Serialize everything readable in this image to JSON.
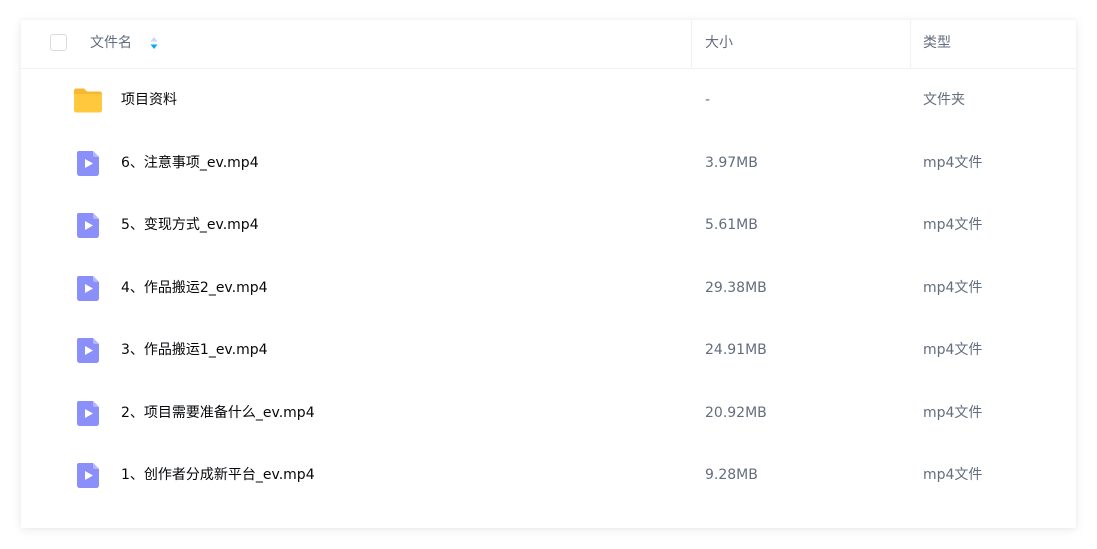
{
  "header": {
    "name_label": "文件名",
    "size_label": "大小",
    "type_label": "类型"
  },
  "colors": {
    "folder": "#ffc83d",
    "video_icon": "#8b8ffa",
    "sort_active": "#06a7ff",
    "sort_inactive": "#c4d9f5"
  },
  "files": [
    {
      "icon": "folder-icon",
      "name": "项目资料",
      "size": "-",
      "type": "文件夹"
    },
    {
      "icon": "video-file-icon",
      "name": "6、注意事项_ev.mp4",
      "size": "3.97MB",
      "type": "mp4文件"
    },
    {
      "icon": "video-file-icon",
      "name": "5、变现方式_ev.mp4",
      "size": "5.61MB",
      "type": "mp4文件"
    },
    {
      "icon": "video-file-icon",
      "name": "4、作品搬运2_ev.mp4",
      "size": "29.38MB",
      "type": "mp4文件"
    },
    {
      "icon": "video-file-icon",
      "name": "3、作品搬运1_ev.mp4",
      "size": "24.91MB",
      "type": "mp4文件"
    },
    {
      "icon": "video-file-icon",
      "name": "2、项目需要准备什么_ev.mp4",
      "size": "20.92MB",
      "type": "mp4文件"
    },
    {
      "icon": "video-file-icon",
      "name": "1、创作者分成新平台_ev.mp4",
      "size": "9.28MB",
      "type": "mp4文件"
    }
  ]
}
